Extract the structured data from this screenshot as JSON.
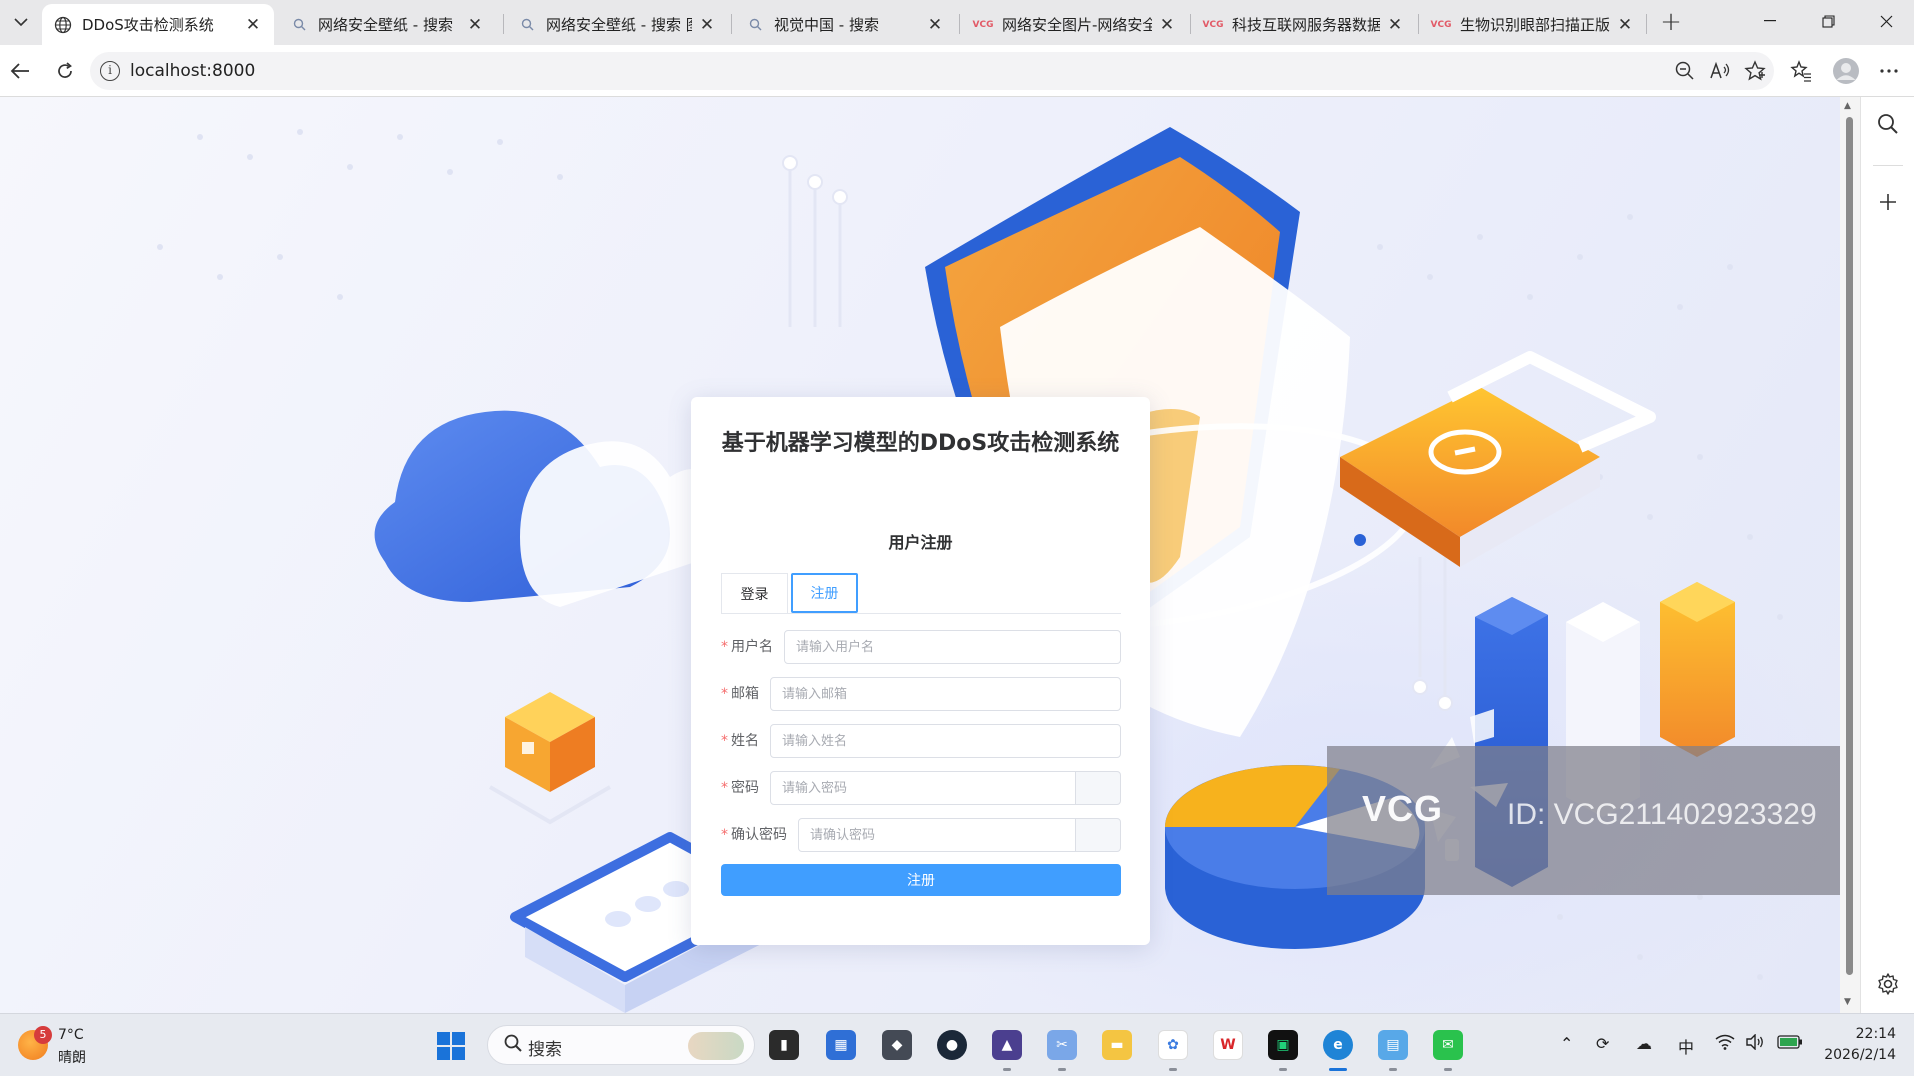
{
  "browser": {
    "tabs": [
      {
        "title": "DDoS攻击检测系统",
        "favicon": "globe-icon",
        "active": true
      },
      {
        "title": "网络安全壁纸 - 搜索",
        "favicon": "search-icon",
        "active": false
      },
      {
        "title": "网络安全壁纸 - 搜索 图",
        "favicon": "search-icon",
        "active": false
      },
      {
        "title": "视觉中国 - 搜索",
        "favicon": "search-icon",
        "active": false
      },
      {
        "title": "网络安全图片-网络安全",
        "favicon": "vcg-icon",
        "favicon_text": "VCG",
        "active": false
      },
      {
        "title": "科技互联网服务器数据",
        "favicon": "vcg-icon",
        "favicon_text": "VCG",
        "active": false
      },
      {
        "title": "生物识别眼部扫描正版",
        "favicon": "vcg-icon",
        "favicon_text": "VCG",
        "active": false
      }
    ],
    "url": "localhost:8000"
  },
  "page": {
    "title": "基于机器学习模型的DDoS攻击检测系统",
    "subtitle": "用户注册",
    "tabs": {
      "login": "登录",
      "register": "注册",
      "active": "register"
    },
    "fields": [
      {
        "label": "用户名",
        "placeholder": "请输入用户名",
        "type": "text"
      },
      {
        "label": "邮箱",
        "placeholder": "请输入邮箱",
        "type": "text"
      },
      {
        "label": "姓名",
        "placeholder": "请输入姓名",
        "type": "text"
      },
      {
        "label": "密码",
        "placeholder": "请输入密码",
        "type": "password"
      },
      {
        "label": "确认密码",
        "placeholder": "请确认密码",
        "type": "password"
      }
    ],
    "submit_label": "注册",
    "required_mark": "*"
  },
  "watermark": {
    "brand": "VCG",
    "id": "ID: VCG211402923329"
  },
  "taskbar": {
    "weather": {
      "badge": "5",
      "temp": "7°C",
      "desc": "晴朗"
    },
    "search_placeholder": "搜索",
    "ime": "中",
    "time": "22:14",
    "date": "2026/2/14"
  },
  "colors": {
    "primary": "#409eff",
    "required": "#f56c6c",
    "text": "#303133"
  }
}
